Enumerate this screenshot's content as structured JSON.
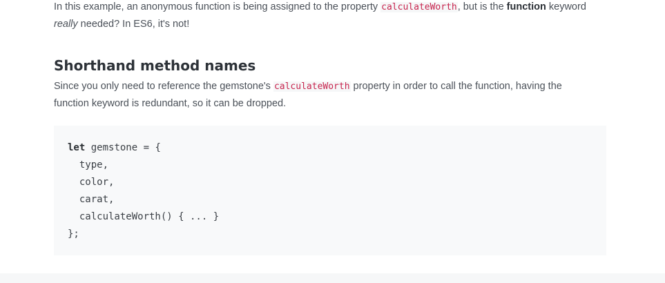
{
  "intro": {
    "part1": "In this example, an anonymous function is being assigned to the property ",
    "code": "calculateWorth",
    "part2": ", but is the ",
    "bold": "function",
    "part3": " keyword",
    "italic": "really",
    "part4": " needed? In ES6, it's not!"
  },
  "section": {
    "heading": "Shorthand method names",
    "part1": "Since you only need to reference the gemstone's ",
    "code": "calculateWorth",
    "part2": " property in order to call the function, having the",
    "line2": "function keyword is redundant, so it can be dropped."
  },
  "code_block": {
    "keyword": "let",
    "line1_rest": " gemstone = {",
    "line2": "  type,",
    "line3": "  color,",
    "line4": "  carat,",
    "line5": "  calculateWorth() { ... }",
    "line6": "};"
  }
}
